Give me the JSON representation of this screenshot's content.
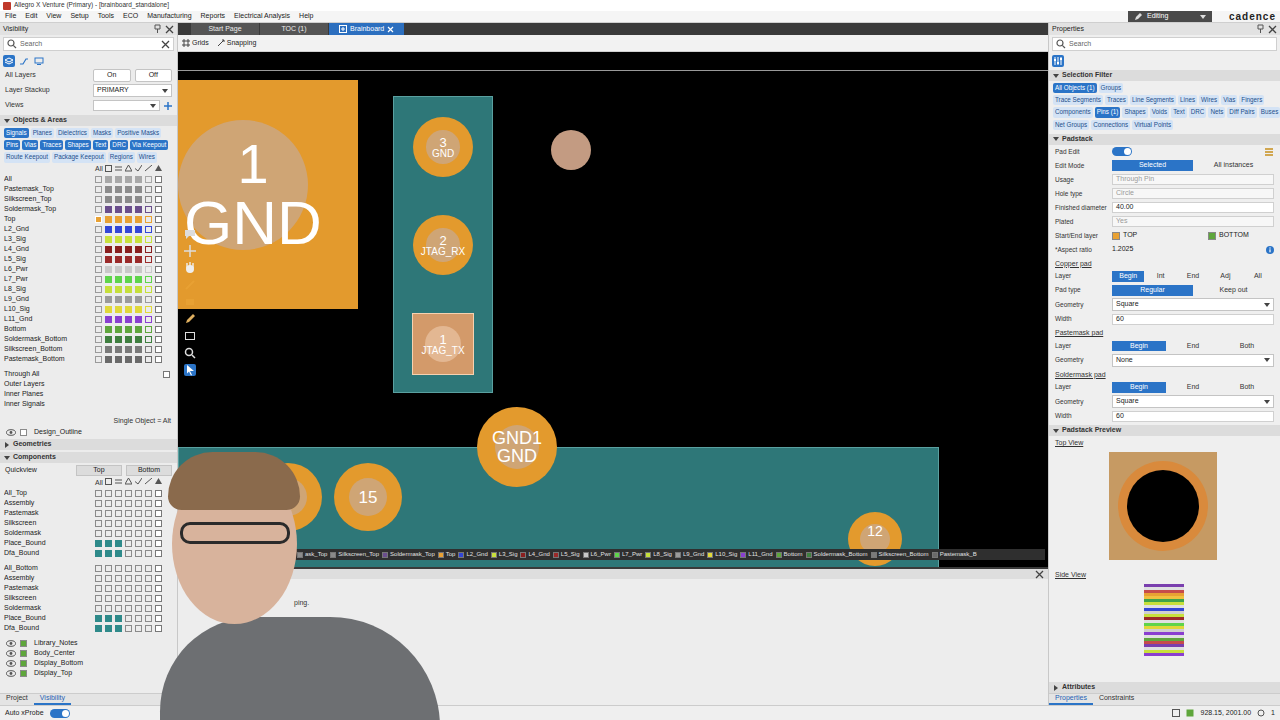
{
  "window": {
    "title": "Allegro X Venture (Primary) - [brainboard_standalone]",
    "mode": "Editing",
    "logo": "cadence"
  },
  "menu": [
    "File",
    "Edit",
    "View",
    "Setup",
    "Tools",
    "ECO",
    "Manufacturing",
    "Reports",
    "Electrical Analysis",
    "Help"
  ],
  "visibility": {
    "title": "Visibility",
    "search": {
      "placeholder": "Search"
    },
    "all_layers": {
      "label": "All Layers",
      "on": "On",
      "off": "Off"
    },
    "stackup": {
      "label": "Layer Stackup",
      "value": "PRIMARY"
    },
    "views": {
      "label": "Views"
    },
    "objects": {
      "title": "Objects & Areas",
      "expanded": true
    },
    "filters": [
      [
        {
          "label": "Signals",
          "selected": true
        },
        {
          "label": "Planes",
          "selected": false
        },
        {
          "label": "Dielectrics",
          "selected": false
        },
        {
          "label": "Masks",
          "selected": false
        },
        {
          "label": "Positive Masks",
          "selected": false
        }
      ],
      [
        {
          "label": "Pins",
          "selected": true
        },
        {
          "label": "Vias",
          "selected": true
        },
        {
          "label": "Traces",
          "selected": true
        },
        {
          "label": "Shapes",
          "selected": true
        },
        {
          "label": "Text",
          "selected": true
        },
        {
          "label": "DRC",
          "selected": true
        },
        {
          "label": "Via Keepout",
          "selected": true
        }
      ],
      [
        {
          "label": "Route Keepout",
          "selected": false
        },
        {
          "label": "Package Keepout",
          "selected": false
        },
        {
          "label": "Regions",
          "selected": false
        },
        {
          "label": "Wires",
          "selected": false
        }
      ]
    ],
    "column_header": "All",
    "layers": [
      {
        "name": "All",
        "color": "#a8a8a8",
        "selected": false
      },
      {
        "name": "Pastemask_Top",
        "color": "#8c8c8c",
        "selected": false
      },
      {
        "name": "Silkscreen_Top",
        "color": "#8a8a8a",
        "selected": false
      },
      {
        "name": "Soldermask_Top",
        "color": "#6a4e8c",
        "selected": false
      },
      {
        "name": "Top",
        "color": "#e8a133",
        "selected": true
      },
      {
        "name": "L2_Gnd",
        "color": "#3347d6",
        "selected": false
      },
      {
        "name": "L3_Sig",
        "color": "#c8e03c",
        "selected": false
      },
      {
        "name": "L4_Gnd",
        "color": "#8a1f1f",
        "selected": false
      },
      {
        "name": "L5_Sig",
        "color": "#9b2a2a",
        "selected": false
      },
      {
        "name": "L6_Pwr",
        "color": "#c8c8c8",
        "selected": false
      },
      {
        "name": "L7_Pwr",
        "color": "#5fd44a",
        "selected": false
      },
      {
        "name": "L8_Sig",
        "color": "#c6df3a",
        "selected": false
      },
      {
        "name": "L9_Gnd",
        "color": "#9a9a9a",
        "selected": false
      },
      {
        "name": "L10_Sig",
        "color": "#e0d83a",
        "selected": false
      },
      {
        "name": "L11_Gnd",
        "color": "#8a3fd0",
        "selected": false
      },
      {
        "name": "Bottom",
        "color": "#5fa63c",
        "selected": false
      },
      {
        "name": "Soldermask_Bottom",
        "color": "#3f7f3f",
        "selected": false
      },
      {
        "name": "Silkscreen_Bottom",
        "color": "#7a7a7a",
        "selected": false
      },
      {
        "name": "Pastemask_Bottom",
        "color": "#6a6a6a",
        "selected": false
      }
    ],
    "through_all": {
      "label": "Through All",
      "checked": false
    },
    "groups": [
      "Outer Layers",
      "Inner Planes",
      "Inner Signals"
    ],
    "hint": "Single Object = Alt",
    "design_outline": {
      "label": "Design_Outline",
      "visible": true
    },
    "geometries": {
      "title": "Geometries",
      "expanded": false
    },
    "components": {
      "title": "Components",
      "expanded": true
    },
    "quickview": {
      "label": "Quickview",
      "top": "Top",
      "bottom": "Bottom"
    },
    "component_header": "All",
    "component_layers": [
      [
        "All_Top",
        "Assembly",
        "Pastemask",
        "Silkscreen",
        "Soldermask",
        "Place_Bound",
        "Dfa_Bound"
      ],
      [
        "All_Bottom",
        "Assembly",
        "Pastemask",
        "Silkscreen",
        "Soldermask",
        "Place_Bound",
        "Dfa_Bound"
      ]
    ],
    "extras": [
      {
        "label": "Library_Notes",
        "visible": true
      },
      {
        "label": "Body_Center",
        "visible": true
      },
      {
        "label": "Display_Bottom",
        "visible": true
      },
      {
        "label": "Display_Top",
        "visible": true
      }
    ],
    "tabs": [
      {
        "label": "Project",
        "selected": false
      },
      {
        "label": "Visibility",
        "selected": true
      }
    ]
  },
  "doc_tabs": [
    {
      "label": "Start Page",
      "selected": false
    },
    {
      "label": "TOC (1)",
      "selected": false
    },
    {
      "label": "Brainboard",
      "selected": true
    }
  ],
  "toolbar": [
    "Grids",
    "Snapping"
  ],
  "canvas": {
    "pads": [
      {
        "number": "1",
        "net": "GND",
        "kind": "large",
        "selected": false
      },
      {
        "number": "3",
        "net": "GND",
        "kind": "round",
        "selected": false
      },
      {
        "number": "2",
        "net": "JTAG_RX",
        "kind": "round",
        "selected": false
      },
      {
        "number": "1",
        "net": "JTAG_TX",
        "kind": "square",
        "selected": true
      },
      {
        "kind": "via",
        "selected": false
      },
      {
        "number": "GND1",
        "net": "GND",
        "kind": "round",
        "selected": false
      },
      {
        "number": "15",
        "kind": "round",
        "selected": false
      },
      {
        "number": "12",
        "kind": "round",
        "selected": false
      },
      {
        "kind": "round",
        "selected": false
      }
    ],
    "legend": [
      {
        "label": "ask_Top",
        "color": "#8c8c8c"
      },
      {
        "label": "Silkscreen_Top",
        "color": "#8a8a8a"
      },
      {
        "label": "Soldermask_Top",
        "color": "#6a4e8c"
      },
      {
        "label": "Top",
        "color": "#e8a133"
      },
      {
        "label": "L2_Gnd",
        "color": "#3347d6"
      },
      {
        "label": "L3_Sig",
        "color": "#c8e03c"
      },
      {
        "label": "L4_Gnd",
        "color": "#8a1f1f"
      },
      {
        "label": "L5_Sig",
        "color": "#9b2a2a"
      },
      {
        "label": "L6_Pwr",
        "color": "#c8c8c8"
      },
      {
        "label": "L7_Pwr",
        "color": "#5fd44a"
      },
      {
        "label": "L8_Sig",
        "color": "#c6df3a"
      },
      {
        "label": "L9_Gnd",
        "color": "#9a9a9a"
      },
      {
        "label": "L10_Sig",
        "color": "#e0d83a"
      },
      {
        "label": "L11_Gnd",
        "color": "#8a3fd0"
      },
      {
        "label": "Bottom",
        "color": "#5fa63c"
      },
      {
        "label": "Soldermask_Bottom",
        "color": "#3f7f3f"
      },
      {
        "label": "Silkscreen_Bottom",
        "color": "#7a7a7a"
      },
      {
        "label": "Pastemask_B",
        "color": "#6a6a6a"
      }
    ]
  },
  "console": {
    "text": "ping."
  },
  "properties": {
    "title": "Properties",
    "search": {
      "placeholder": "Search"
    },
    "selection_filter": {
      "title": "Selection Filter",
      "expanded": true,
      "rows": [
        [
          {
            "label": "All Objects (1)",
            "selected": true
          },
          {
            "label": "Groups",
            "selected": false
          }
        ],
        [
          {
            "label": "Trace Segments",
            "selected": false
          },
          {
            "label": "Traces",
            "selected": false
          },
          {
            "label": "Line Segments",
            "selected": false
          },
          {
            "label": "Lines",
            "selected": false
          },
          {
            "label": "Wires",
            "selected": false
          },
          {
            "label": "Vias",
            "selected": false
          },
          {
            "label": "Fingers",
            "selected": false
          }
        ],
        [
          {
            "label": "Components",
            "selected": false
          },
          {
            "label": "Pins (1)",
            "selected": true
          },
          {
            "label": "Shapes",
            "selected": false
          },
          {
            "label": "Voids",
            "selected": false
          },
          {
            "label": "Text",
            "selected": false
          },
          {
            "label": "DRC",
            "selected": false
          },
          {
            "label": "Nets",
            "selected": false
          },
          {
            "label": "Diff Pairs",
            "selected": false
          },
          {
            "label": "Buses",
            "selected": false
          }
        ],
        [
          {
            "label": "Net Groups",
            "selected": false
          },
          {
            "label": "Connections",
            "selected": false
          },
          {
            "label": "Virtual Points",
            "selected": false
          }
        ]
      ]
    },
    "padstack": {
      "title": "Padstack",
      "expanded": true,
      "pad_edit": {
        "label": "Pad Edit",
        "on": true
      },
      "edit_mode": {
        "label": "Edit Mode",
        "options": [
          {
            "label": "Selected",
            "selected": true
          },
          {
            "label": "All instances",
            "selected": false
          }
        ]
      },
      "fields": [
        {
          "label": "Usage",
          "value": "Through Pin",
          "disabled": true
        },
        {
          "label": "Hole type",
          "value": "Circle",
          "disabled": true
        },
        {
          "label": "Finished diameter",
          "value": "40.00",
          "disabled": false
        },
        {
          "label": "Plated",
          "value": "Yes",
          "disabled": true
        }
      ],
      "start_end": {
        "label": "Start/End layer",
        "layers": [
          {
            "name": "TOP",
            "color": "#e8a133"
          },
          {
            "name": "BOTTOM",
            "color": "#5fa63c"
          }
        ]
      },
      "aspect": {
        "label": "*Aspect ratio",
        "value": "1.2025"
      },
      "sections": [
        {
          "title": "Copper pad",
          "rows": [
            {
              "kind": "segmented",
              "label": "Layer",
              "options": [
                {
                  "label": "Begin",
                  "selected": true
                },
                {
                  "label": "Int",
                  "selected": false
                },
                {
                  "label": "End",
                  "selected": false
                },
                {
                  "label": "Adj",
                  "selected": false
                },
                {
                  "label": "All",
                  "selected": false
                }
              ]
            },
            {
              "kind": "segmented",
              "label": "Pad type",
              "options": [
                {
                  "label": "Regular",
                  "selected": true
                },
                {
                  "label": "Keep out",
                  "selected": false
                }
              ]
            },
            {
              "kind": "select",
              "label": "Geometry",
              "value": "Square"
            },
            {
              "kind": "input",
              "label": "Width",
              "value": "60"
            }
          ]
        },
        {
          "title": "Pastemask pad",
          "rows": [
            {
              "kind": "segmented",
              "label": "Layer",
              "options": [
                {
                  "label": "Begin",
                  "selected": true
                },
                {
                  "label": "End",
                  "selected": false
                },
                {
                  "label": "Both",
                  "selected": false
                }
              ]
            },
            {
              "kind": "select",
              "label": "Geometry",
              "value": "None"
            }
          ]
        },
        {
          "title": "Soldermask pad",
          "rows": [
            {
              "kind": "segmented",
              "label": "Layer",
              "options": [
                {
                  "label": "Begin",
                  "selected": true
                },
                {
                  "label": "End",
                  "selected": false
                },
                {
                  "label": "Both",
                  "selected": false
                }
              ]
            },
            {
              "kind": "select",
              "label": "Geometry",
              "value": "Square"
            },
            {
              "kind": "input",
              "label": "Width",
              "value": "60"
            }
          ]
        }
      ]
    },
    "preview": {
      "title": "Padstack Preview",
      "expanded": true,
      "top_view": "Top View",
      "side_view": "Side View"
    },
    "attributes": {
      "title": "Attributes",
      "expanded": false
    },
    "tabs": [
      {
        "label": "Properties",
        "selected": true
      },
      {
        "label": "Constraints",
        "selected": false
      }
    ]
  },
  "status": {
    "xprobe": {
      "label": "Auto xProbe",
      "on": true
    },
    "coords": "928.15, 2001.00",
    "page": "1"
  }
}
